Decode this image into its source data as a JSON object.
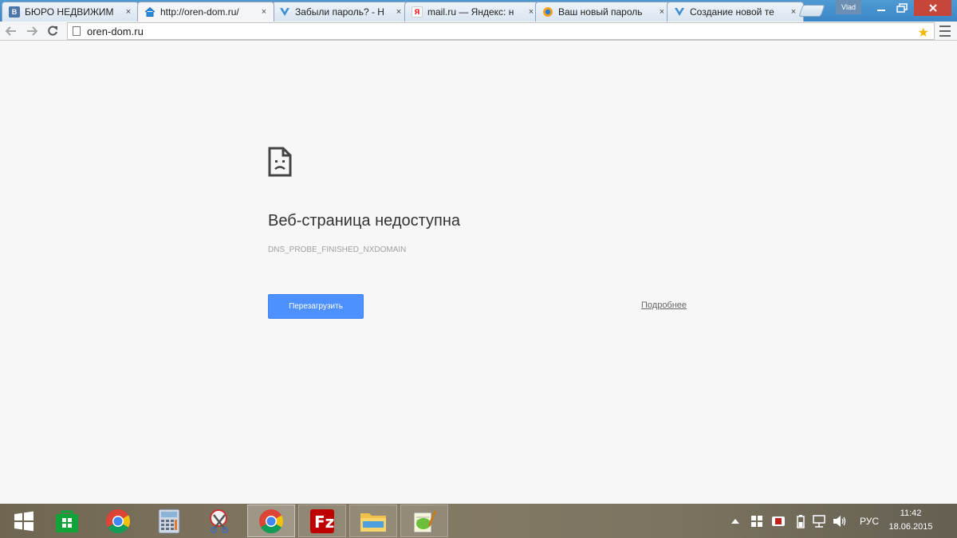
{
  "browser": {
    "tabs": [
      {
        "title": "БЮРО НЕДВИЖИМ",
        "favicon": "vk-icon"
      },
      {
        "title": "http://oren-dom.ru/",
        "favicon": "home-icon"
      },
      {
        "title": "Забыли пароль? - Н",
        "favicon": "forum-icon"
      },
      {
        "title": "mail.ru — Яндекс: н",
        "favicon": "yandex-icon"
      },
      {
        "title": "Ваш новый пароль",
        "favicon": "mail-icon"
      },
      {
        "title": "Создание новой те",
        "favicon": "forum-icon"
      }
    ],
    "close_glyph": "×",
    "user_badge": "Vlad",
    "address": "oren-dom.ru"
  },
  "error_page": {
    "title": "Веб-страница недоступна",
    "code": "DNS_PROBE_FINISHED_NXDOMAIN",
    "reload_label": "Перезагрузить",
    "details_label": "Подробнее"
  },
  "taskbar": {
    "apps": [
      "windows-start",
      "windows-store",
      "chrome",
      "calculator",
      "snipping-tool",
      "chrome-active",
      "filezilla",
      "file-explorer",
      "notepad-plus-plus"
    ],
    "language": "РУС",
    "time": "11:42",
    "date": "18.06.2015"
  },
  "colors": {
    "accent": "#4d90fe",
    "titlebar": "#3c86c8",
    "page_bg": "#f7f7f7"
  }
}
